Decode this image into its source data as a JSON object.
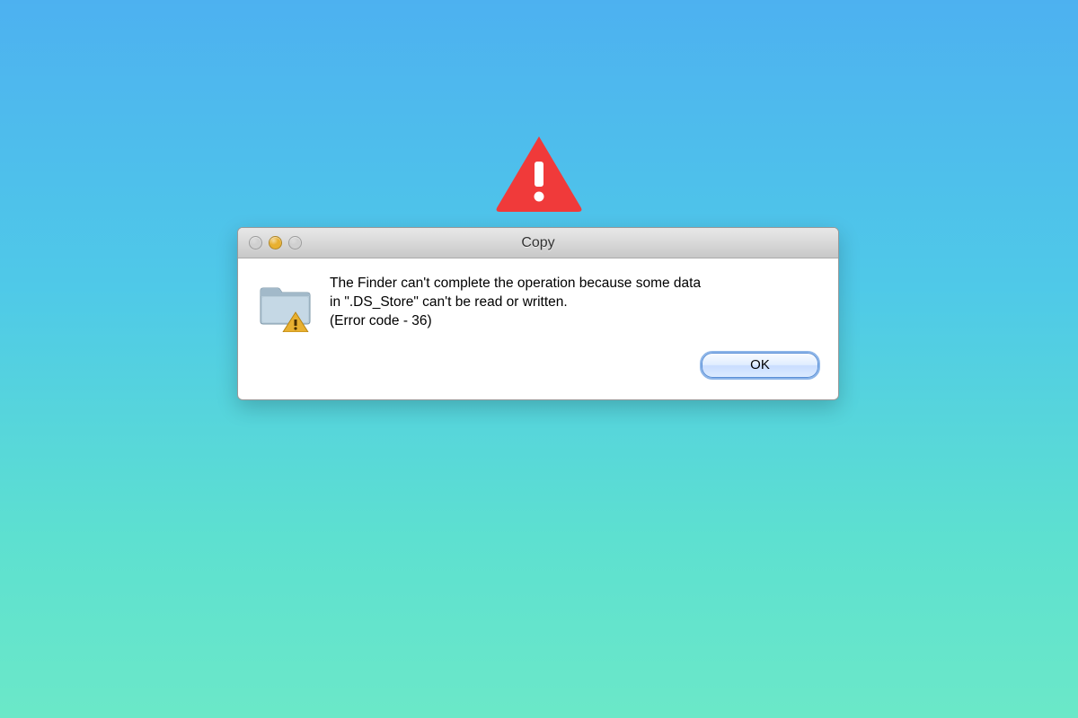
{
  "dialog": {
    "title": "Copy",
    "message_line1": "The Finder can't complete the operation because some data",
    "message_line2": "in \".DS_Store\" can't be read or written.",
    "message_line3": "(Error code - 36)",
    "ok_label": "OK"
  }
}
